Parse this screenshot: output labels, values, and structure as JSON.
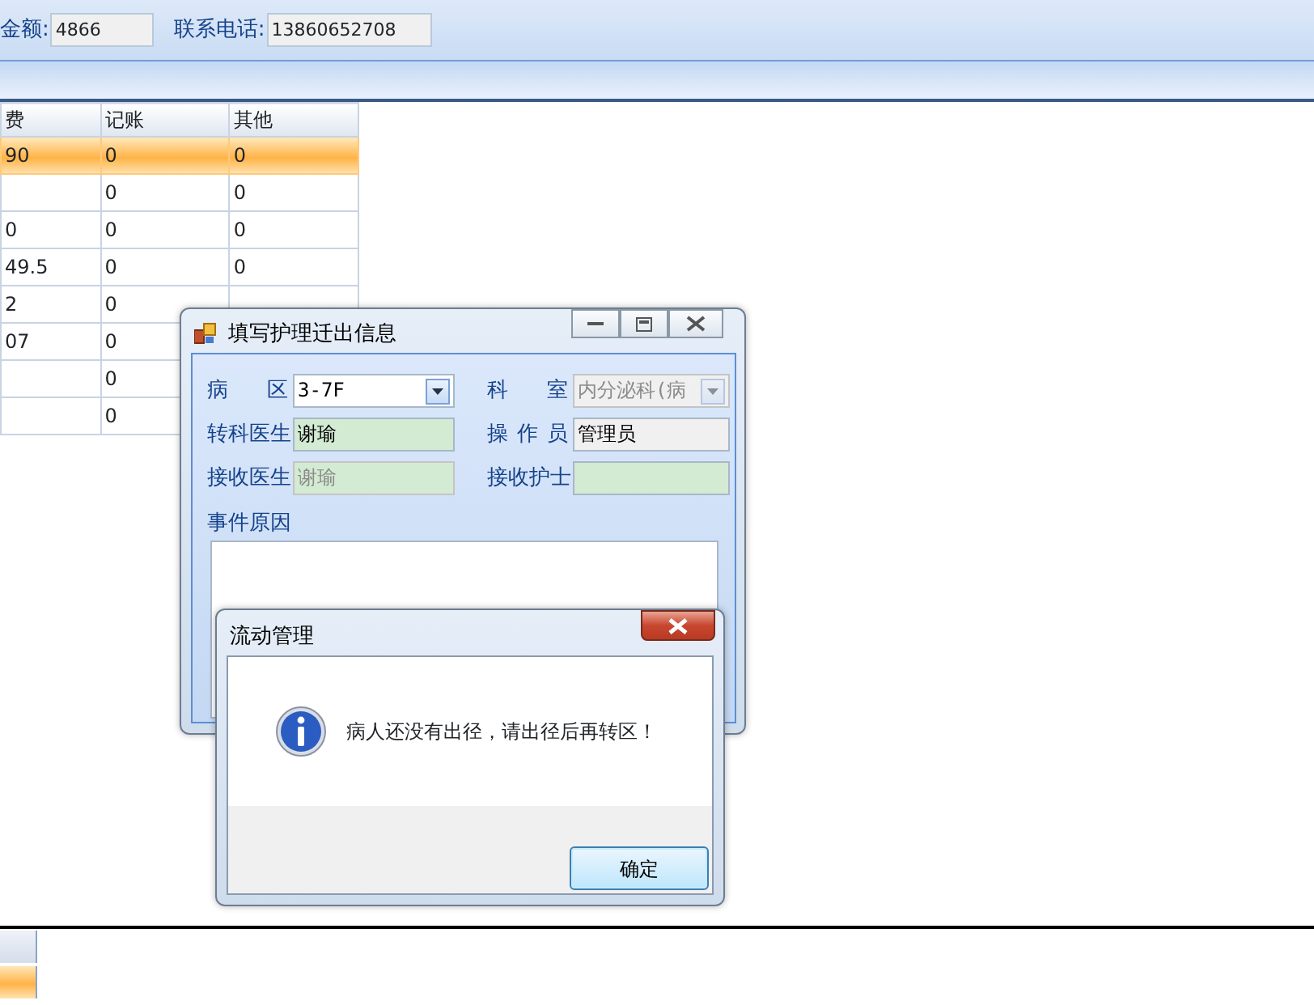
{
  "top_bar": {
    "fields": [
      {
        "label": "金额:",
        "value": "4866"
      },
      {
        "label": "联系电话:",
        "value": "13860652708"
      }
    ]
  },
  "table": {
    "columns": [
      "费",
      "记账",
      "其他"
    ],
    "rows": [
      {
        "cells": [
          "90",
          "0",
          "0"
        ],
        "selected": true
      },
      {
        "cells": [
          "",
          "0",
          "0"
        ],
        "selected": false
      },
      {
        "cells": [
          "0",
          "0",
          "0"
        ],
        "selected": false
      },
      {
        "cells": [
          "49.5",
          "0",
          "0"
        ],
        "selected": false
      },
      {
        "cells": [
          "2",
          "0",
          ""
        ],
        "selected": false
      },
      {
        "cells": [
          "07",
          "0",
          ""
        ],
        "selected": false
      },
      {
        "cells": [
          "",
          "0",
          ""
        ],
        "selected": false
      },
      {
        "cells": [
          "",
          "0",
          ""
        ],
        "selected": false
      }
    ]
  },
  "form_dialog": {
    "title": "填写护理迁出信息",
    "fields": [
      {
        "label": "病 区",
        "value": "3-7F",
        "kind": "combo",
        "disabled": false,
        "color": "#ffffff"
      },
      {
        "label": "科 室",
        "value": "内分泌科(病",
        "kind": "combo",
        "disabled": true,
        "color": "#f0f0f0"
      },
      {
        "label": "转科医生",
        "value": "谢瑜",
        "kind": "text",
        "disabled": false,
        "color": "#d3ead3"
      },
      {
        "label": "操 作 员",
        "value": "管理员",
        "kind": "text",
        "disabled": false,
        "color": "#f0f0f0"
      },
      {
        "label": "接收医生",
        "value": "谢瑜",
        "kind": "text",
        "disabled": true,
        "color": "#d3ead3"
      },
      {
        "label": "接收护士",
        "kind": "text",
        "disabled": false,
        "color": "#d3ead3"
      }
    ],
    "reason_label": "事件原因"
  },
  "message_box": {
    "title": "流动管理",
    "message": "病人还没有出径，请出径后再转区！",
    "button": "确定"
  },
  "bottom_grid": {
    "rows": [
      {
        "selected": false
      },
      {
        "selected": true
      }
    ]
  }
}
